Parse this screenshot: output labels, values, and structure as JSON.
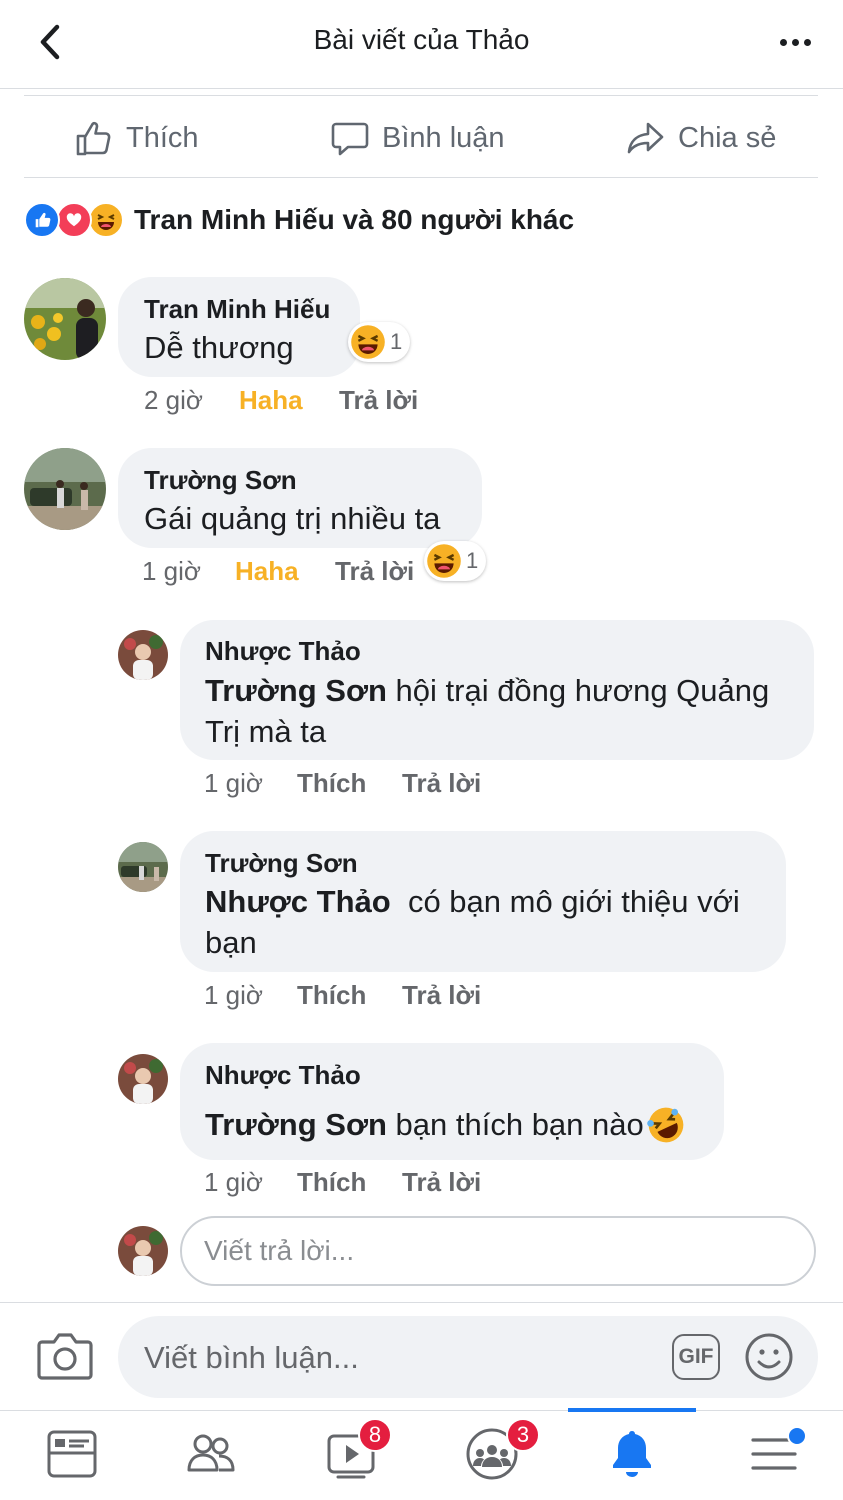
{
  "header": {
    "title": "Bài viết của Thảo"
  },
  "actions": {
    "like": "Thích",
    "comment": "Bình luận",
    "share": "Chia sẻ"
  },
  "reactions_summary": {
    "text": "Tran Minh Hiếu và 80 người khác"
  },
  "comments": [
    {
      "author": "Tran Minh Hiếu",
      "text": "Dễ thương",
      "time": "2 giờ",
      "reaction_label": "Haha",
      "reply_label": "Trả lời",
      "reaction_count": "1"
    },
    {
      "author": "Trường Sơn",
      "text": "Gái quảng trị nhiều ta",
      "time": "1 giờ",
      "reaction_label": "Haha",
      "reply_label": "Trả lời",
      "reaction_count": "1"
    }
  ],
  "replies": [
    {
      "author": "Nhược Thảo",
      "mention": "Trường Sơn",
      "text_line1": " hội trại đồng hương Quảng",
      "text_line2": "Trị mà ta",
      "time": "1 giờ",
      "like_label": "Thích",
      "reply_label": "Trả lời"
    },
    {
      "author": "Trường Sơn",
      "mention": "Nhược Thảo",
      "text_line1": "  có bạn mô giới thiệu với",
      "text_line2": "bạn",
      "time": "1 giờ",
      "like_label": "Thích",
      "reply_label": "Trả lời"
    },
    {
      "author": "Nhược Thảo",
      "mention": "Trường Sơn",
      "text_line1": " bạn thích bạn nào",
      "time": "1 giờ",
      "like_label": "Thích",
      "reply_label": "Trả lời"
    }
  ],
  "reply_input": {
    "placeholder": "Viết trả lời..."
  },
  "composer": {
    "placeholder": "Viết bình luận...",
    "gif_label": "GIF"
  },
  "tabbar": {
    "items": [
      "news-feed-icon",
      "friends-icon",
      "watch-icon",
      "groups-icon",
      "notifications-icon",
      "menu-icon"
    ],
    "watch_badge": "8",
    "groups_badge": "3"
  },
  "colors": {
    "accent": "#1877f2",
    "haha": "#f7b125",
    "badge": "#e41e3f",
    "bubble": "#f0f2f5"
  }
}
